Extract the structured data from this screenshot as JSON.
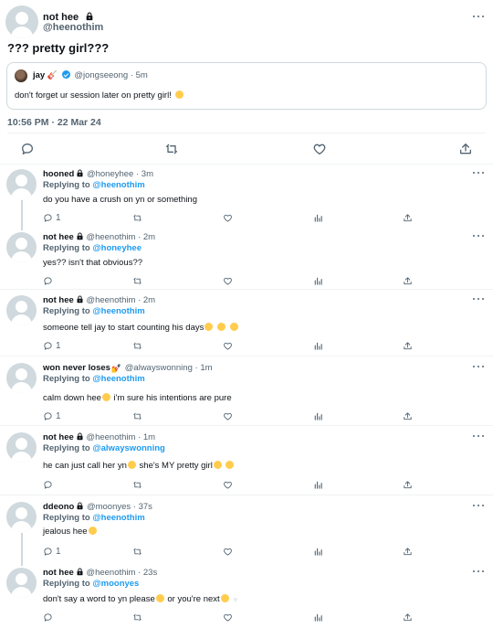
{
  "main_tweet": {
    "display_name": "not hee",
    "handle": "@heenothim",
    "text": "??? pretty girl???",
    "timestamp": "10:56 PM · 22 Mar 24",
    "quote": {
      "display_name": "jay",
      "handle": "@jongseeong",
      "time": "5m",
      "text": "don't forget ur session later on pretty girl!"
    }
  },
  "replies": [
    {
      "display_name": "hooned",
      "handle": "@honeyhee",
      "time": "3m",
      "replying_label": "Replying to",
      "replying_to": "@heenothim",
      "text": "do you have a crush on yn or something",
      "reply_count": "1"
    },
    {
      "display_name": "not hee",
      "handle": "@heenothim",
      "time": "2m",
      "replying_label": "Replying to",
      "replying_to": "@honeyhee",
      "text": "yes?? isn't that obvious??",
      "reply_count": ""
    },
    {
      "display_name": "not hee",
      "handle": "@heenothim",
      "time": "2m",
      "replying_label": "Replying to",
      "replying_to": "@heenothim",
      "text": "someone tell jay to start counting his days",
      "reply_count": "1"
    },
    {
      "display_name": "won never loses",
      "handle": "@alwayswonning",
      "time": "1m",
      "replying_label": "Replying to",
      "replying_to": "@heenothim",
      "text_a": "calm down hee",
      "text_b": " i'm sure his intentions are pure",
      "reply_count": "1"
    },
    {
      "display_name": "not hee",
      "handle": "@heenothim",
      "time": "1m",
      "replying_label": "Replying to",
      "replying_to": "@alwayswonning",
      "text_a": "he can just call her yn",
      "text_b": " she's MY pretty girl",
      "reply_count": ""
    },
    {
      "display_name": "ddeono",
      "handle": "@moonyes",
      "time": "37s",
      "replying_label": "Replying to",
      "replying_to": "@heenothim",
      "text": "jealous hee",
      "reply_count": "1"
    },
    {
      "display_name": "not hee",
      "handle": "@heenothim",
      "time": "23s",
      "replying_label": "Replying to",
      "replying_to": "@moonyes",
      "text_a": "don't say a word to yn please",
      "text_b": " or you're next",
      "reply_count": ""
    }
  ],
  "colors": {
    "link": "#1d9bf0",
    "muted": "#536471",
    "text": "#0f1419",
    "border": "#cfd9de"
  },
  "icons": [
    "lock-icon",
    "verified-icon",
    "more-icon",
    "reply-icon",
    "retweet-icon",
    "like-icon",
    "views-icon",
    "share-icon"
  ]
}
